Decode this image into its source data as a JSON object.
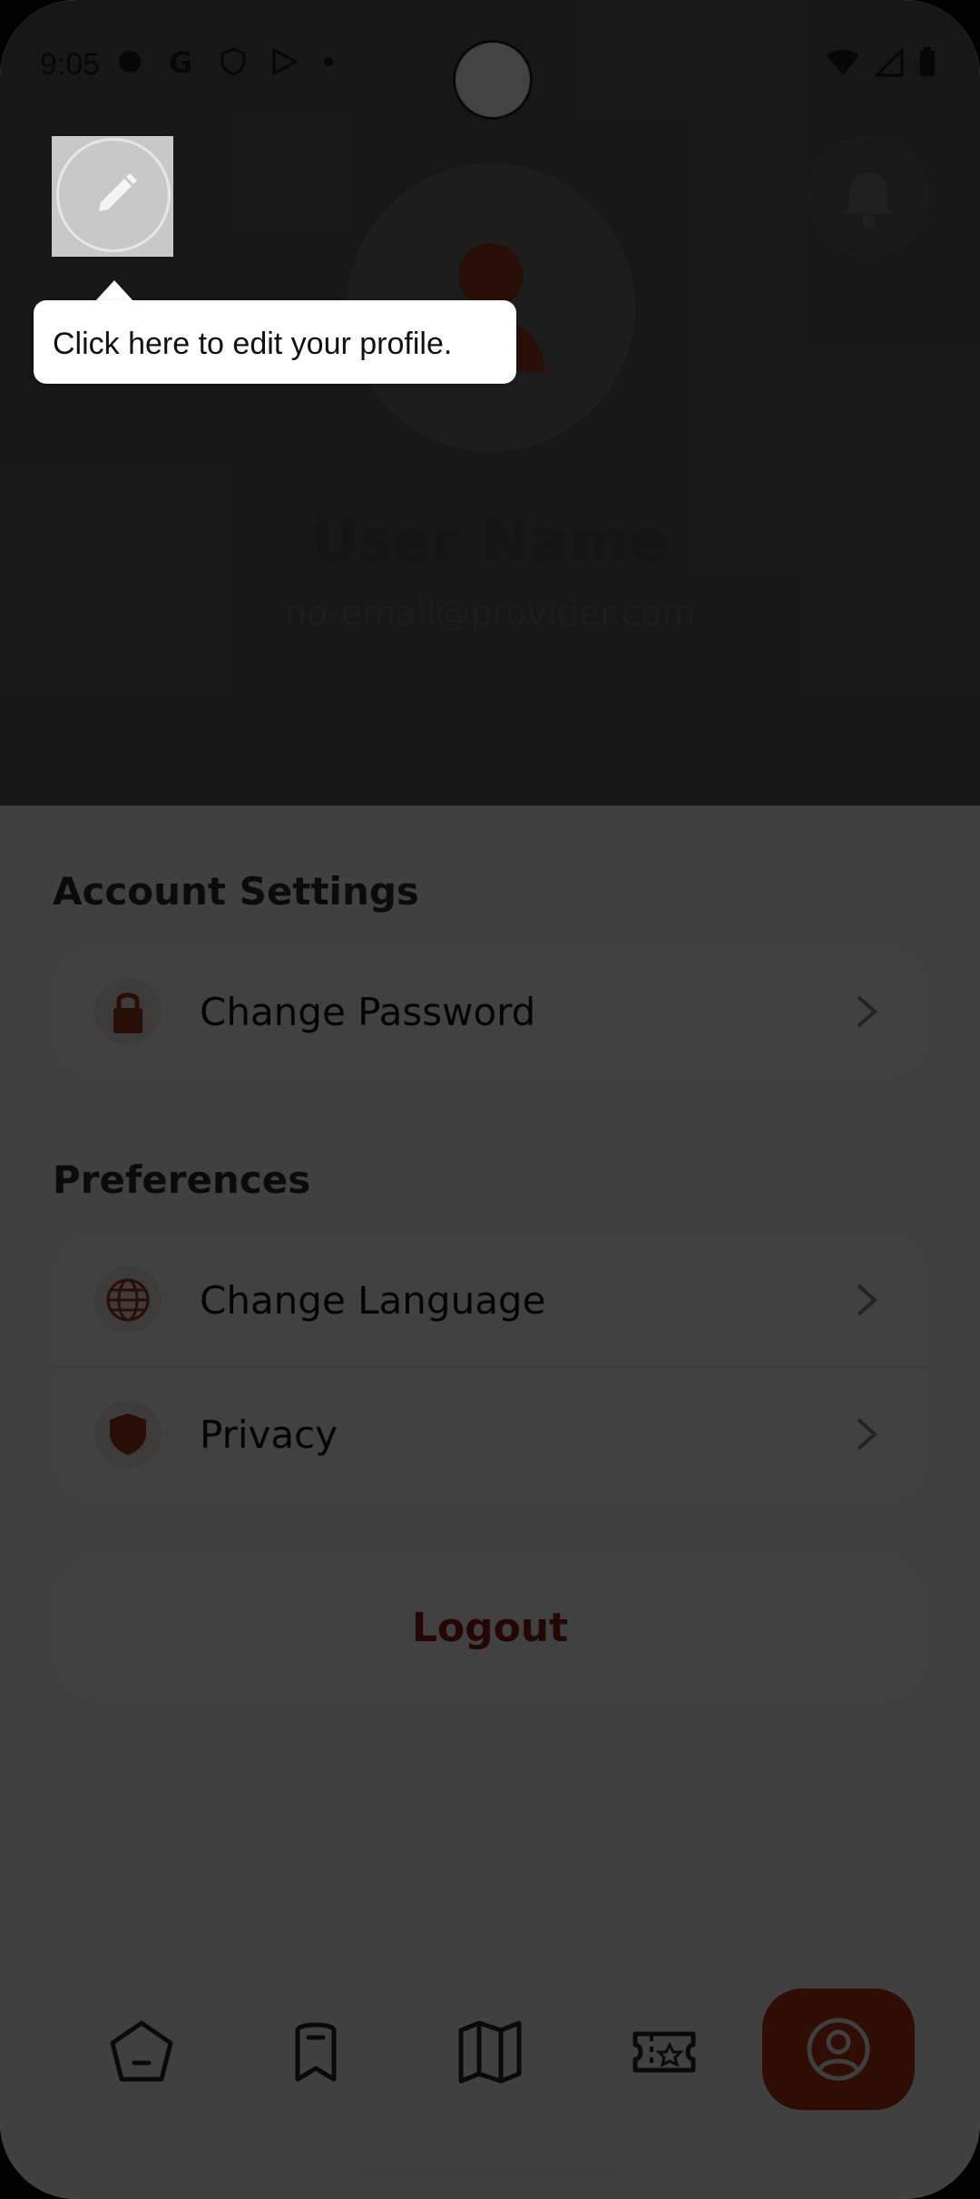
{
  "status_bar": {
    "time": "9:05"
  },
  "tooltip": {
    "text": "Click here to edit your profile."
  },
  "profile": {
    "name": "User Name",
    "email": "no-email@provider.com"
  },
  "sections": {
    "account": {
      "title": "Account Settings",
      "items": [
        {
          "label": "Change Password",
          "icon": "lock-icon"
        }
      ]
    },
    "preferences": {
      "title": "Preferences",
      "items": [
        {
          "label": "Change Language",
          "icon": "globe-icon"
        },
        {
          "label": "Privacy",
          "icon": "shield-icon"
        }
      ]
    }
  },
  "logout": {
    "label": "Logout"
  },
  "bottom_nav": {
    "items": [
      "home-icon",
      "bookmark-icon",
      "map-icon",
      "ticket-icon",
      "profile-icon"
    ],
    "active": "profile-icon"
  },
  "colors": {
    "accent": "#b53312",
    "overlay": "#000000"
  }
}
